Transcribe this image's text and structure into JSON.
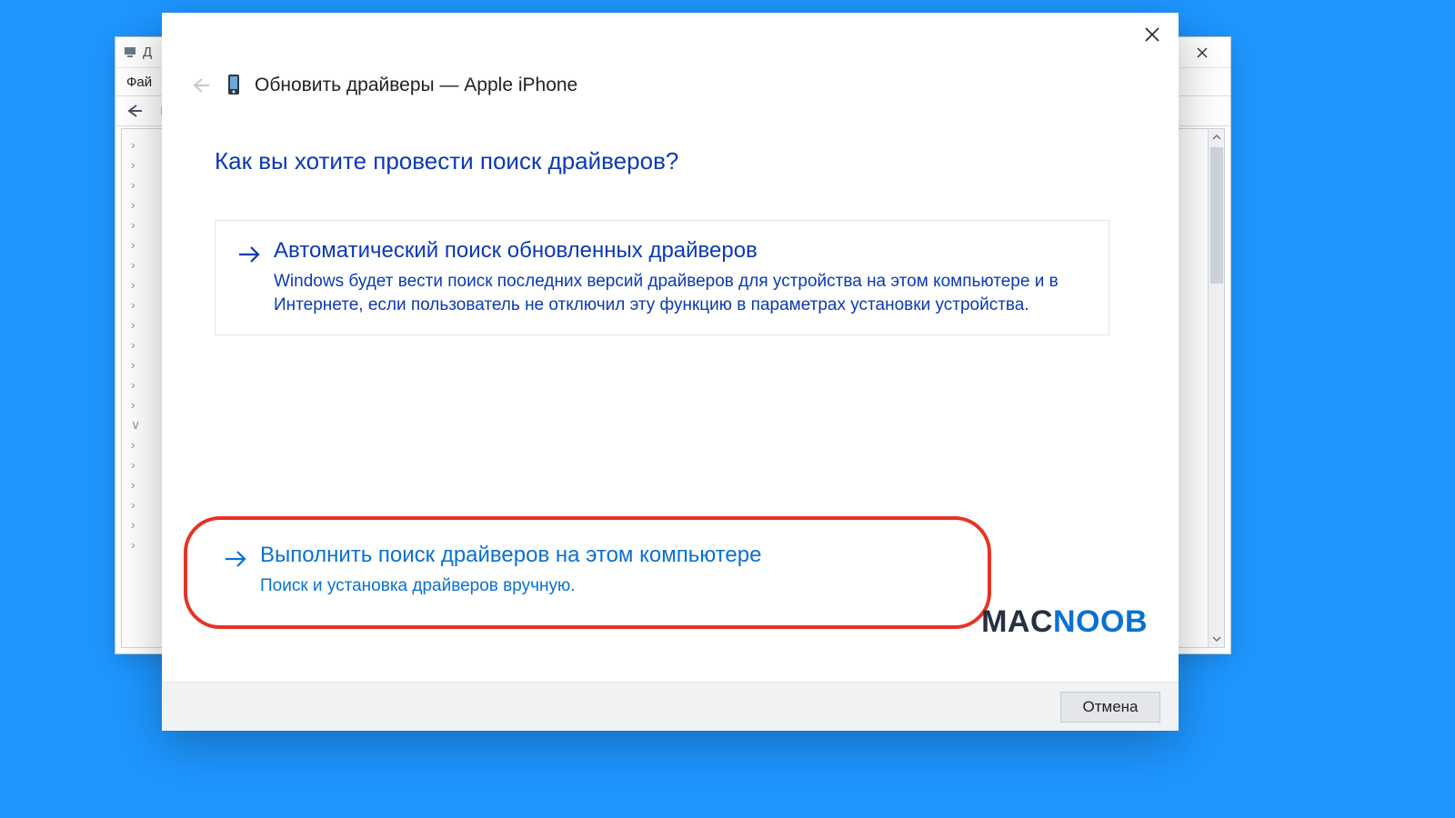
{
  "background_window": {
    "title_fragment": "Д",
    "menu_file": "Фай"
  },
  "dialog": {
    "title": "Обновить драйверы — Apple iPhone",
    "question": "Как вы хотите провести поиск драйверов?",
    "option_auto": {
      "title": "Автоматический поиск обновленных драйверов",
      "desc": "Windows будет вести поиск последних версий драйверов для устройства на этом компьютере и в Интернете, если пользователь не отключил эту функцию в параметрах установки устройства."
    },
    "option_manual": {
      "title": "Выполнить поиск драйверов на этом компьютере",
      "desc": "Поиск и установка драйверов вручную."
    },
    "cancel": "Отмена"
  },
  "watermark": {
    "part1": "MAC",
    "part2": "NOOB"
  }
}
